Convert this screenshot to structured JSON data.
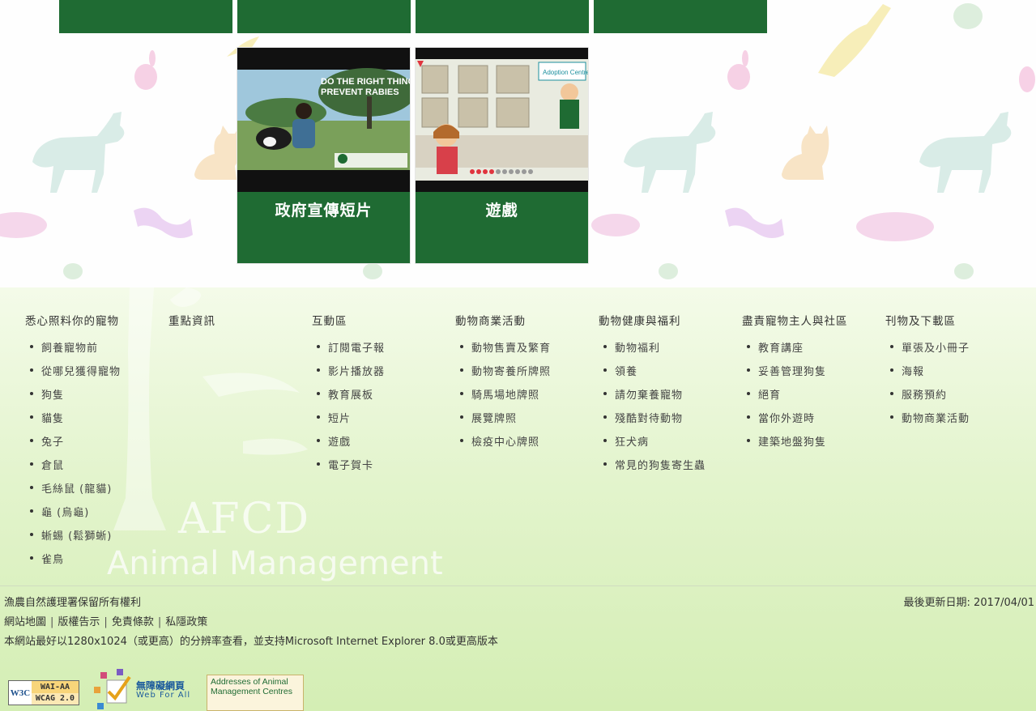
{
  "tiles": [
    {
      "label": "政府宣傳短片",
      "thumb_title": "DO THE RIGHT THING PREVENT RABIES",
      "thumb_org": "漁農自然護理署 Agriculture, Fisheries and Conservation Department"
    },
    {
      "label": "遊戲",
      "thumb_title": "Adoption Centre"
    }
  ],
  "nav": [
    {
      "heading": "悉心照料你的寵物",
      "items": [
        "飼養寵物前",
        "從哪兒獲得寵物",
        "狗隻",
        "貓隻",
        "兔子",
        "倉鼠",
        "毛絲鼠 (龍貓)",
        "龜 (烏龜)",
        "蜥蜴 (鬆獅蜥)",
        "雀鳥"
      ]
    },
    {
      "heading": "重點資訊",
      "items": []
    },
    {
      "heading": "互動區",
      "items": [
        "訂閱電子報",
        "影片播放器",
        "教育展板",
        "短片",
        "遊戲",
        "電子賀卡"
      ]
    },
    {
      "heading": "動物商業活動",
      "items": [
        "動物售賣及繁育",
        "動物寄養所牌照",
        "騎馬場地牌照",
        "展覽牌照",
        "檢疫中心牌照"
      ]
    },
    {
      "heading": "動物健康與福利",
      "items": [
        "動物福利",
        "領養",
        "請勿棄養寵物",
        "殘酷對待動物",
        "狂犬病",
        "常見的狗隻寄生蟲"
      ]
    },
    {
      "heading": "盡責寵物主人與社區",
      "items": [
        "教育講座",
        "妥善管理狗隻",
        "絕育",
        "當你外遊時",
        "建築地盤狗隻"
      ]
    },
    {
      "heading": "刊物及下載區",
      "items": [
        "單張及小冊子",
        "海報",
        "服務預約",
        "動物商業活動"
      ]
    }
  ],
  "watermark": {
    "line1": "AFCD",
    "line2": "Animal Management"
  },
  "footer": {
    "copyright": "漁農自然護理署保留所有權利",
    "last_updated": "最後更新日期: 2017/04/01",
    "links": [
      "網站地圖",
      "版權告示",
      "免責條款",
      "私隱政策"
    ],
    "browser_note": "本網站最好以1280x1024（或更高）的分辨率查看，並支持Microsoft Internet Explorer 8.0或更高版本"
  },
  "badges": {
    "w3c_left": "W3C",
    "w3c_top": "WAI-AA",
    "w3c_bottom": "WCAG 2.0",
    "webforall_cn": "無障礙網頁",
    "webforall_en": "Web For All",
    "addresses": "Addresses of Animal Management Centres"
  },
  "colors": {
    "tile_green": "#1f6b33",
    "footer_bg": "#d4eeb4"
  }
}
